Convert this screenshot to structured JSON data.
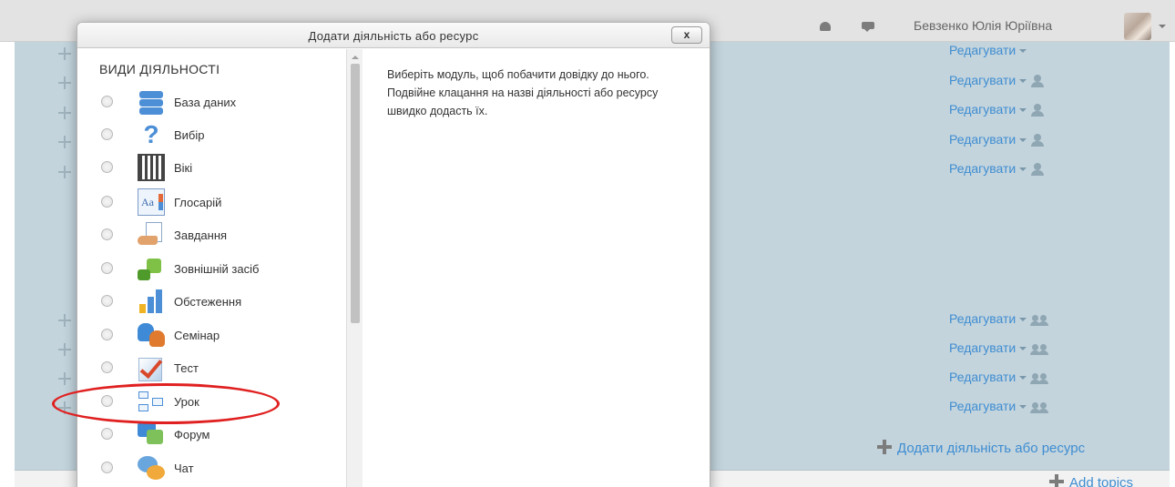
{
  "header": {
    "user_name": "Бевзенко Юлія Юріївна",
    "icons": [
      "bell-icon",
      "message-icon"
    ]
  },
  "background": {
    "edit_links": [
      {
        "label": "Редагувати",
        "icon": "person-icon"
      },
      {
        "label": "Редагувати",
        "icon": "person-icon"
      },
      {
        "label": "Редагувати",
        "icon": "person-icon"
      },
      {
        "label": "Редагувати",
        "icon": "person-icon"
      },
      {
        "label": "Редагувати",
        "icon": "person-icon"
      },
      {
        "label": "Редагувати",
        "icon": "group-icon"
      },
      {
        "label": "Редагувати",
        "icon": "group-icon"
      },
      {
        "label": "Редагувати",
        "icon": "group-icon"
      },
      {
        "label": "Редагувати",
        "icon": "group-icon"
      }
    ],
    "add_activity_label": "Додати діяльність або ресурс",
    "add_topics_label": "Add topics"
  },
  "modal": {
    "title": "Додати діяльність або ресурс",
    "close_label": "x",
    "section_heading": "ВИДИ ДІЯЛЬНОСТІ",
    "help_text": "Виберіть модуль, щоб побачити довідку до нього. Подвійне клацання на назві діяльності або ресурсу швидко додасть їх.",
    "options": [
      {
        "label": "База даних",
        "icon": "database-icon"
      },
      {
        "label": "Вибір",
        "icon": "choice-icon"
      },
      {
        "label": "Вікі",
        "icon": "wiki-icon"
      },
      {
        "label": "Глосарій",
        "icon": "glossary-icon"
      },
      {
        "label": "Завдання",
        "icon": "assignment-icon"
      },
      {
        "label": "Зовнішній засіб",
        "icon": "external-tool-icon"
      },
      {
        "label": "Обстеження",
        "icon": "survey-icon"
      },
      {
        "label": "Семінар",
        "icon": "workshop-icon"
      },
      {
        "label": "Тест",
        "icon": "quiz-icon"
      },
      {
        "label": "Урок",
        "icon": "lesson-icon"
      },
      {
        "label": "Форум",
        "icon": "forum-icon"
      },
      {
        "label": "Чат",
        "icon": "chat-icon"
      }
    ]
  },
  "annotation": {
    "highlighted_option": "Урок",
    "color": "#e02020"
  }
}
